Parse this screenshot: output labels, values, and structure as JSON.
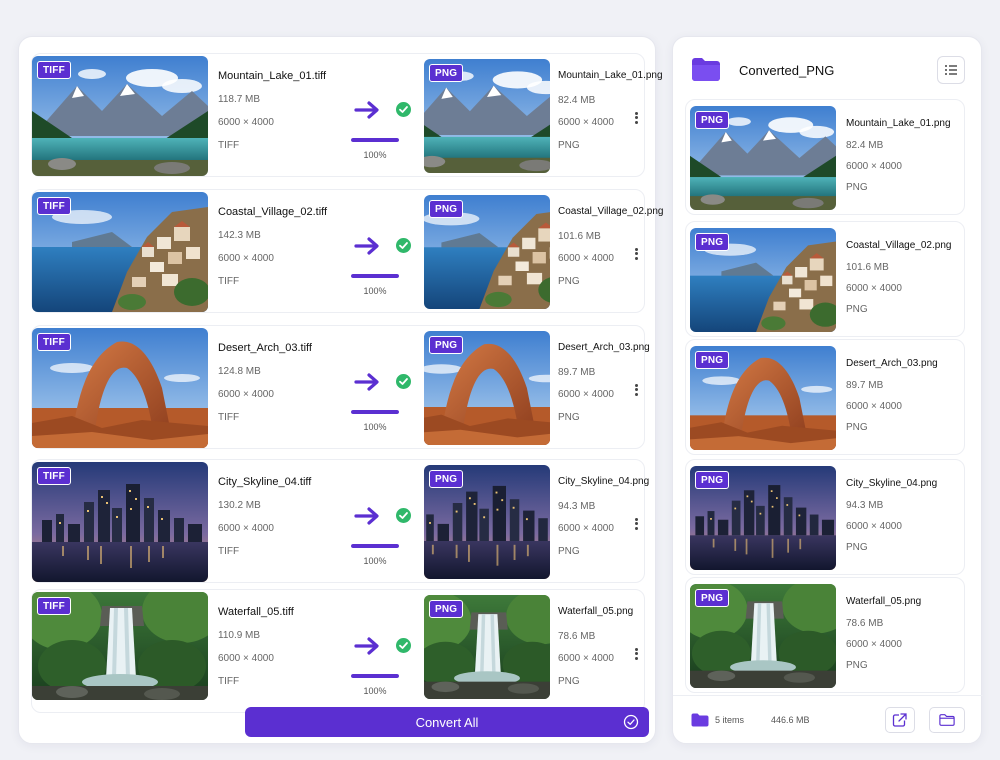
{
  "conversions": [
    {
      "source": {
        "name": "Mountain_Lake_01.tiff",
        "size": "118.7 MB",
        "dimensions": "6000 × 4000",
        "format": "TIFF",
        "badge": "TIFF"
      },
      "output": {
        "name": "Mountain_Lake_01.png",
        "size": "82.4 MB",
        "dimensions": "6000 × 4000",
        "format": "PNG",
        "badge": "PNG"
      },
      "progress_percent": 100,
      "progress_label": "100%"
    },
    {
      "source": {
        "name": "Coastal_Village_02.tiff",
        "size": "142.3 MB",
        "dimensions": "6000 × 4000",
        "format": "TIFF",
        "badge": "TIFF"
      },
      "output": {
        "name": "Coastal_Village_02.png",
        "size": "101.6 MB",
        "dimensions": "6000 × 4000",
        "format": "PNG",
        "badge": "PNG"
      },
      "progress_percent": 100,
      "progress_label": "100%"
    },
    {
      "source": {
        "name": "Desert_Arch_03.tiff",
        "size": "124.8 MB",
        "dimensions": "6000 × 4000",
        "format": "TIFF",
        "badge": "TIFF"
      },
      "output": {
        "name": "Desert_Arch_03.png",
        "size": "89.7 MB",
        "dimensions": "6000 × 4000",
        "format": "PNG",
        "badge": "PNG"
      },
      "progress_percent": 100,
      "progress_label": "100%"
    },
    {
      "source": {
        "name": "City_Skyline_04.tiff",
        "size": "130.2 MB",
        "dimensions": "6000 × 4000",
        "format": "TIFF",
        "badge": "TIFF"
      },
      "output": {
        "name": "City_Skyline_04.png",
        "size": "94.3 MB",
        "dimensions": "6000 × 4000",
        "format": "PNG",
        "badge": "PNG"
      },
      "progress_percent": 100,
      "progress_label": "100%"
    },
    {
      "source": {
        "name": "Waterfall_05.tiff",
        "size": "110.9 MB",
        "dimensions": "6000 × 4000",
        "format": "TIFF",
        "badge": "TIFF"
      },
      "output": {
        "name": "Waterfall_05.png",
        "size": "78.6 MB",
        "dimensions": "6000 × 4000",
        "format": "PNG",
        "badge": "PNG"
      },
      "progress_percent": 100,
      "progress_label": "100%"
    }
  ],
  "convert_all_label": "Convert All",
  "output_panel": {
    "folder_name": "Converted_PNG",
    "items": [
      {
        "name": "Mountain_Lake_01.png",
        "size": "82.4 MB",
        "dimensions": "6000 × 4000",
        "format": "PNG",
        "badge": "PNG"
      },
      {
        "name": "Coastal_Village_02.png",
        "size": "101.6 MB",
        "dimensions": "6000 × 4000",
        "format": "PNG",
        "badge": "PNG"
      },
      {
        "name": "Desert_Arch_03.png",
        "size": "89.7 MB",
        "dimensions": "6000 × 4000",
        "format": "PNG",
        "badge": "PNG"
      },
      {
        "name": "City_Skyline_04.png",
        "size": "94.3 MB",
        "dimensions": "6000 × 4000",
        "format": "PNG",
        "badge": "PNG"
      },
      {
        "name": "Waterfall_05.png",
        "size": "78.6 MB",
        "dimensions": "6000 × 4000",
        "format": "PNG",
        "badge": "PNG"
      }
    ],
    "items_count": "5 items",
    "total_size": "446.6 MB"
  },
  "colors": {
    "accent": "#5b2fd1",
    "success": "#2fb86a",
    "background": "#f0f1f6"
  },
  "icons": [
    "arrow-right-icon",
    "check-circle-icon",
    "more-vertical-icon",
    "folder-icon",
    "list-view-icon",
    "open-external-icon",
    "check-outline-icon"
  ]
}
